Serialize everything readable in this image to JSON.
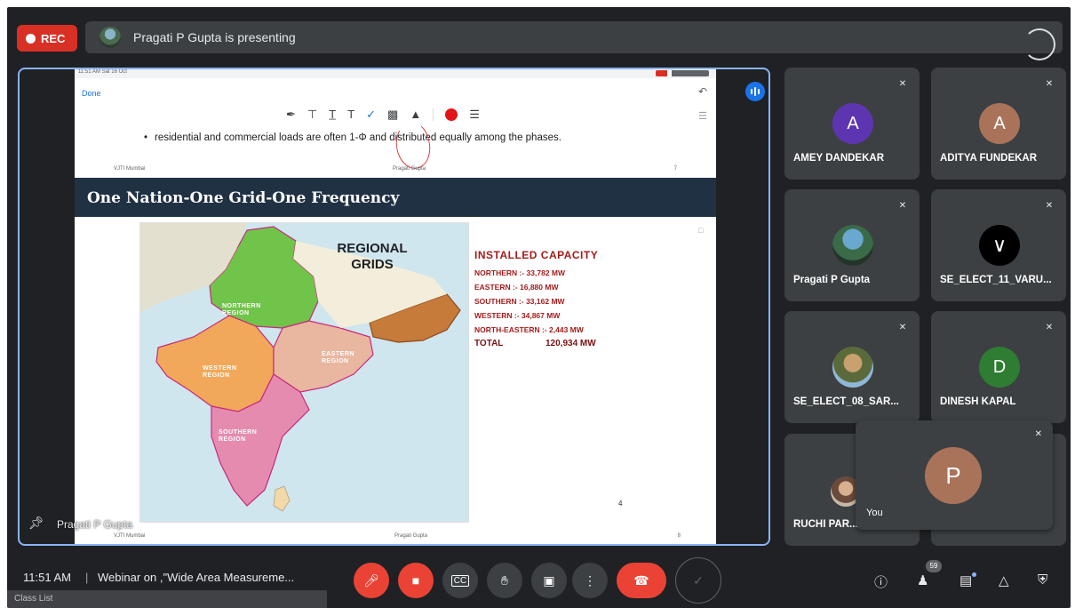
{
  "top": {
    "rec_label": "REC",
    "presenting_text": "Pragati P Gupta is presenting"
  },
  "slide": {
    "status_time": "11:51 AM  Sat 16 Oct",
    "done_label": "Done",
    "bullet_text": "residential and commercial loads are often 1-Φ and distributed equally among the phases.",
    "prev_footer_left": "VJTI Mumbai",
    "prev_footer_center": "Pragati Gupta",
    "prev_footer_right": "7",
    "title": "One Nation-One Grid-One Frequency",
    "map_title_line1": "REGIONAL",
    "map_title_line2": "GRIDS",
    "regions": {
      "northern": "NORTHERN\nREGION",
      "western": "WESTERN\nREGION",
      "eastern": "EASTERN\nREGION",
      "southern": "SOUTHERN\nREGION"
    },
    "capacity": {
      "heading": "INSTALLED CAPACITY",
      "rows": [
        "NORTHERN :- 33,782 MW",
        "EASTERN  :- 16,880 MW",
        "SOUTHERN :- 33,162 MW",
        "WESTERN  :- 34,867 MW",
        "NORTH-EASTERN :- 2,443 MW"
      ],
      "total_label": "TOTAL",
      "total_value": "120,934 MW"
    },
    "page_number": "4",
    "footer_left": "VJTI Mumbai",
    "footer_center": "Pragati Gupta",
    "footer_right": "8"
  },
  "stage": {
    "presenter_name": "Pragati P Gupta"
  },
  "participants": [
    {
      "name": "AMEY DANDEKAR",
      "initial": "A",
      "color": "#5e35b1"
    },
    {
      "name": "ADITYA FUNDEKAR",
      "initial": "A",
      "color": "#a9735a"
    },
    {
      "name": "Pragati P Gupta",
      "initial": "",
      "color": "#3c4043"
    },
    {
      "name": "SE_ELECT_11_VARU...",
      "initial": "",
      "color": "#000000"
    },
    {
      "name": "SE_ELECT_08_SAR...",
      "initial": "",
      "color": "#8fb8d8"
    },
    {
      "name": "DINESH KAPAL",
      "initial": "D",
      "color": "#2e7d32"
    },
    {
      "name": "RUCHI PAR...",
      "initial": "",
      "color": "#c9b7a5"
    }
  ],
  "self": {
    "name": "You",
    "initial": "P",
    "color": "#a9735a"
  },
  "bottom": {
    "time": "11:51 AM",
    "separator": "|",
    "meeting_title": "Webinar on ,\"Wide Area Measureme...",
    "people_count": "59",
    "class_list": "Class List"
  }
}
